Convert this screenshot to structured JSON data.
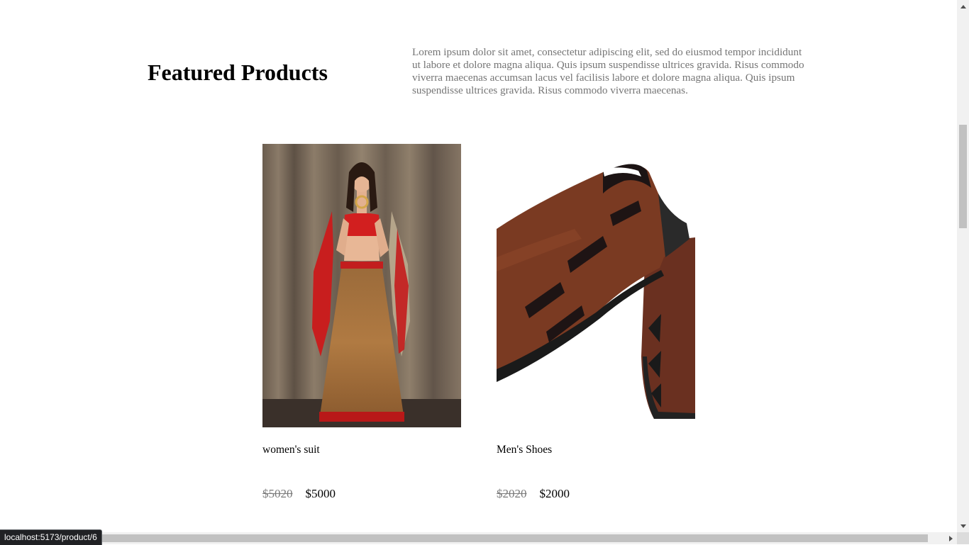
{
  "section": {
    "title": "Featured Products",
    "description": "Lorem ipsum dolor sit amet, consectetur adipiscing elit, sed do eiusmod tempor incididunt ut labore et dolore magna aliqua. Quis ipsum suspendisse ultrices gravida. Risus commodo viverra maecenas accumsan lacus vel facilisis labore et dolore magna aliqua. Quis ipsum suspendisse ultrices gravida. Risus commodo viverra maecenas."
  },
  "products": [
    {
      "name": "women's suit",
      "old_price": "$5020",
      "price": "$5000",
      "image": "woman in red lehenga"
    },
    {
      "name": "Men's Shoes",
      "old_price": "$2020",
      "price": "$2000",
      "image": "brown leather sandal shoes"
    }
  ],
  "status_bar": {
    "url": "localhost:5173/product/6"
  },
  "colors": {
    "muted_text": "#757575",
    "strike_price": "#7a7a7a",
    "status_bg": "#202124"
  }
}
